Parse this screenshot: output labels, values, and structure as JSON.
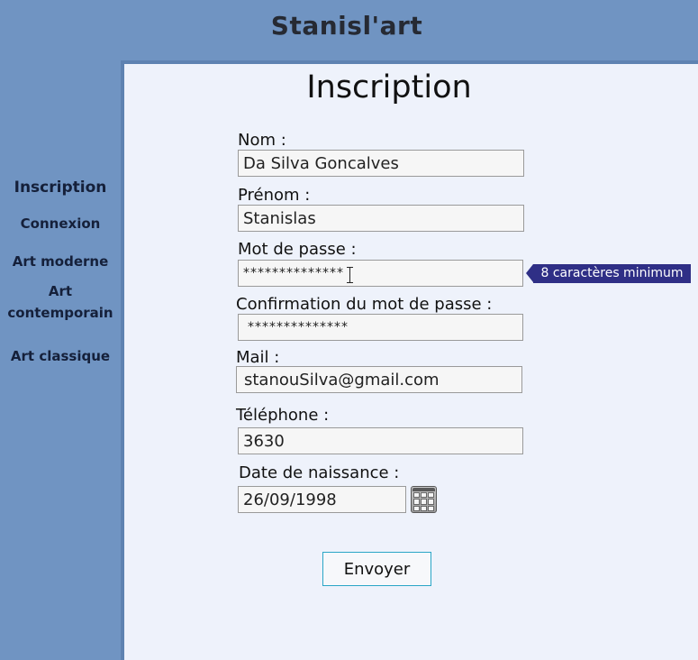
{
  "header": {
    "site_title": "Stanisl'art"
  },
  "sidebar": {
    "items": [
      {
        "label": "Inscription"
      },
      {
        "label": "Connexion"
      },
      {
        "label": "Art moderne"
      },
      {
        "label": "Art contemporain"
      },
      {
        "label": "Art classique"
      }
    ]
  },
  "form": {
    "title": "Inscription",
    "nom": {
      "label": "Nom :",
      "value": "Da Silva Goncalves"
    },
    "prenom": {
      "label": "Prénom :",
      "value": "Stanislas"
    },
    "password": {
      "label": "Mot de passe :",
      "value": "**************",
      "hint": "8 caractères minimum"
    },
    "confirm": {
      "label": "Confirmation du mot de passe :",
      "value": "**************"
    },
    "mail": {
      "label": "Mail :",
      "value": "stanouSilva@gmail.com"
    },
    "telephone": {
      "label": "Téléphone :",
      "value": "3630"
    },
    "birthdate": {
      "label": "Date de naissance :",
      "value": "26/09/1998"
    },
    "submit_label": "Envoyer"
  },
  "icons": {
    "calendar": "calendar-icon"
  },
  "colors": {
    "background": "#7094c2",
    "content": "#eef2fb",
    "hint": "#2f2f86",
    "button_border": "#2aa6c7"
  }
}
